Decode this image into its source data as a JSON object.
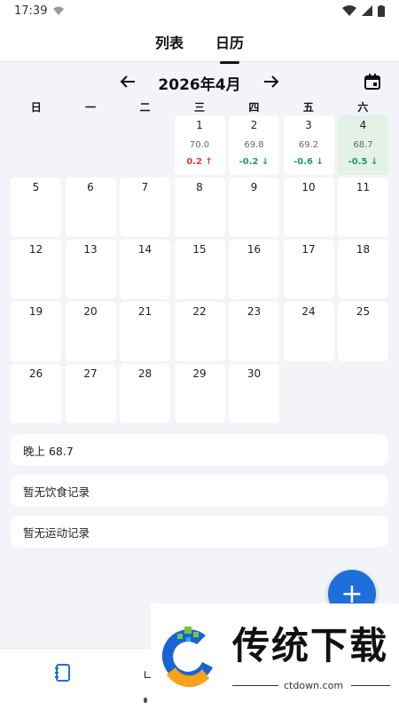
{
  "status": {
    "time": "17:39"
  },
  "tabs": [
    {
      "label": "列表"
    },
    {
      "label": "日历"
    }
  ],
  "month": {
    "title": "2026年4月",
    "prev_icon": "arrow-left-icon",
    "next_icon": "arrow-right-icon",
    "calendar_icon": "calendar-icon"
  },
  "weekdays": [
    "日",
    "一",
    "二",
    "三",
    "四",
    "五",
    "六"
  ],
  "days": [
    {
      "day": "",
      "blank": true
    },
    {
      "day": "",
      "blank": true
    },
    {
      "day": "",
      "blank": true
    },
    {
      "day": "1",
      "weight": "70.0",
      "delta": "0.2 ↑",
      "trend": "up"
    },
    {
      "day": "2",
      "weight": "69.8",
      "delta": "-0.2 ↓",
      "trend": "down"
    },
    {
      "day": "3",
      "weight": "69.2",
      "delta": "-0.6 ↓",
      "trend": "down"
    },
    {
      "day": "4",
      "weight": "68.7",
      "delta": "-0.5 ↓",
      "trend": "down",
      "today": true
    },
    {
      "day": "5"
    },
    {
      "day": "6"
    },
    {
      "day": "7"
    },
    {
      "day": "8"
    },
    {
      "day": "9"
    },
    {
      "day": "10"
    },
    {
      "day": "11"
    },
    {
      "day": "12"
    },
    {
      "day": "13"
    },
    {
      "day": "14"
    },
    {
      "day": "15"
    },
    {
      "day": "16"
    },
    {
      "day": "17"
    },
    {
      "day": "18"
    },
    {
      "day": "19"
    },
    {
      "day": "20"
    },
    {
      "day": "21"
    },
    {
      "day": "22"
    },
    {
      "day": "23"
    },
    {
      "day": "24"
    },
    {
      "day": "25"
    },
    {
      "day": "26"
    },
    {
      "day": "27"
    },
    {
      "day": "28"
    },
    {
      "day": "29"
    },
    {
      "day": "30"
    }
  ],
  "cards": {
    "evening_weight": "晚上 68.7",
    "diet": "暂无饮食记录",
    "exercise": "暂无运动记录"
  },
  "fab": {
    "label": "+"
  },
  "bottom_nav": {
    "chart_label": "ㄴ"
  },
  "overlay": {
    "title": "传统下载",
    "url": "ctdown.com"
  },
  "colors": {
    "accent": "#1e6fd9",
    "today_bg": "#e3f1e7",
    "up": "#e53935",
    "down": "#1a9c6b"
  }
}
